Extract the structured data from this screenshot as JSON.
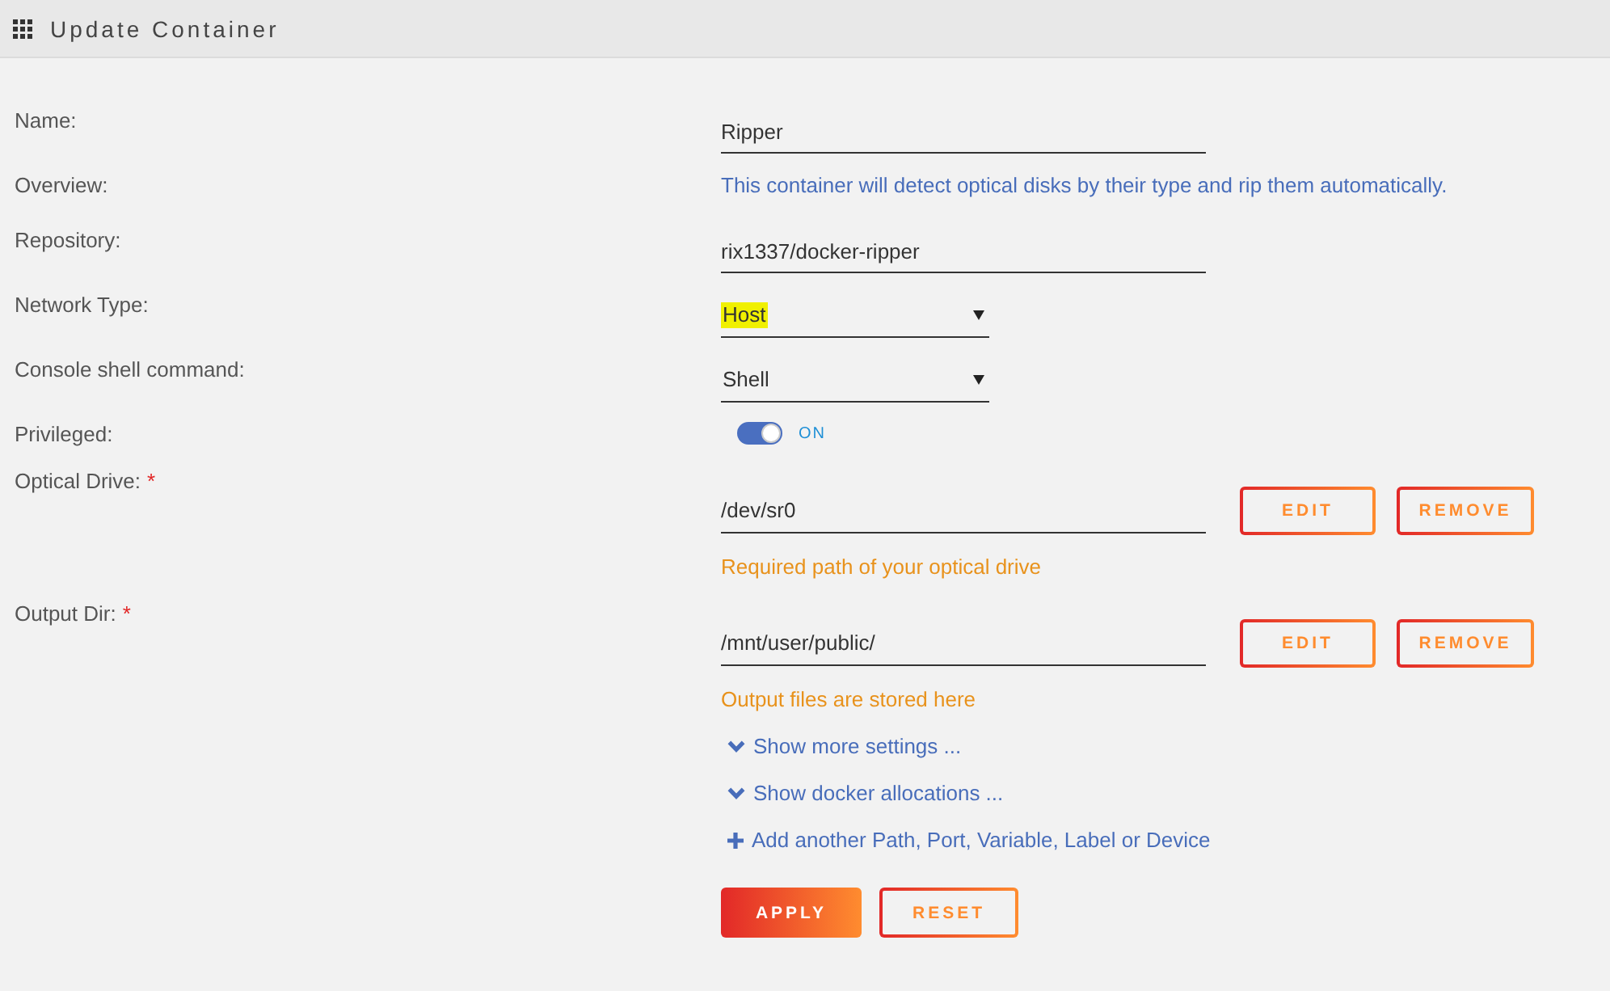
{
  "header": {
    "title": "Update Container"
  },
  "fields": [
    {
      "kind": "input",
      "label": "Name:",
      "value": "Ripper"
    },
    {
      "kind": "text",
      "label": "Overview:",
      "value": "This container will detect optical disks by their type and rip them automatically."
    },
    {
      "kind": "input",
      "label": "Repository:",
      "value": "rix1337/docker-ripper"
    },
    {
      "kind": "select",
      "label": "Network Type:",
      "value": "Host",
      "highlighted": true
    },
    {
      "kind": "select",
      "label": "Console shell command:",
      "value": "Shell",
      "highlighted": false
    },
    {
      "kind": "toggle",
      "label": "Privileged:",
      "on": true,
      "state_label": "ON"
    },
    {
      "kind": "path",
      "label": "Optical Drive:",
      "required_mark": "*",
      "value": "/dev/sr0",
      "help": "Required path of your optical drive",
      "buttons": [
        "EDIT",
        "REMOVE"
      ]
    },
    {
      "kind": "path",
      "label": "Output Dir:",
      "required_mark": "*",
      "value": "/mnt/user/public/",
      "help": "Output files are stored here",
      "buttons": [
        "EDIT",
        "REMOVE"
      ]
    }
  ],
  "links": [
    {
      "kind": "expand",
      "label": "Show more settings ..."
    },
    {
      "kind": "expand",
      "label": "Show docker allocations ..."
    },
    {
      "kind": "add",
      "label": "Add another Path, Port, Variable, Label or Device"
    }
  ],
  "actions": [
    {
      "kind": "primary",
      "label": "APPLY"
    },
    {
      "kind": "secondary",
      "label": "RESET"
    }
  ]
}
